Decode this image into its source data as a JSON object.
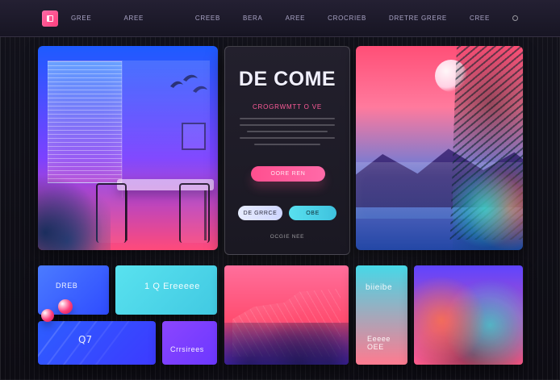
{
  "topbar": {
    "logo": {
      "icon": "square-logo-icon",
      "color": "#ff4f8f"
    },
    "nav_left": [
      "GREE",
      "AREE"
    ],
    "nav_right": [
      "CREEB",
      "BERA",
      "AREE",
      "CROCRIEB",
      "DRETRE GRERE",
      "CREE"
    ],
    "right_dot_icon": "circle-dot-icon"
  },
  "hero": {
    "headline": "DE COME",
    "subhead": "CROGRWMTT O VE",
    "primary_button": "OORE REN",
    "secondary_button": "DE GRRCE",
    "tertiary_button": "OBE",
    "caption": "OCGIE NEE"
  },
  "tiles": {
    "t1_label": "DREB",
    "t2_label": "1 Q Ereeeee",
    "t3_label": "Q7",
    "t4_label": "Crrsirees",
    "t6_label_top": "biieibe",
    "t6_label_bottom": "Eeeee\nOEE"
  },
  "colors": {
    "accent_pink": "#ff4f8f",
    "accent_cyan": "#58d6e6",
    "accent_blue": "#2b6cff",
    "accent_purple": "#8a3cff"
  }
}
